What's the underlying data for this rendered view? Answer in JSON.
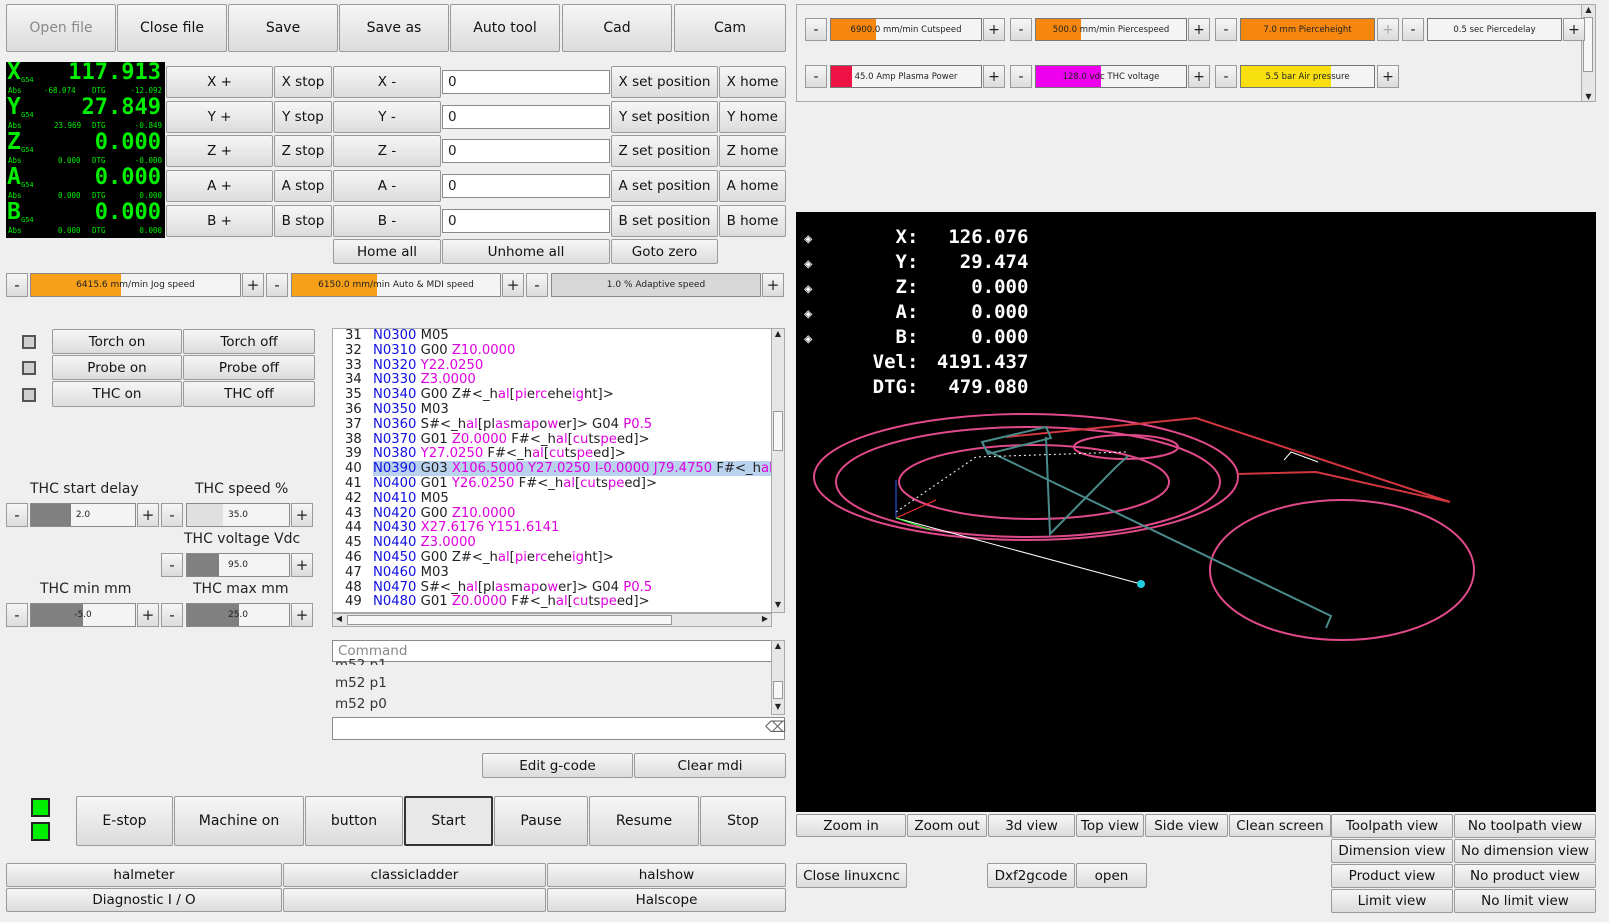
{
  "toolbar": [
    "Open file",
    "Close file",
    "Save",
    "Save as",
    "Auto tool",
    "Cad",
    "Cam"
  ],
  "dro": [
    {
      "axis": "X",
      "g": "G54",
      "value": "117.913",
      "abs": "-68.074",
      "dtg": "-12.092"
    },
    {
      "axis": "Y",
      "g": "G54",
      "value": "27.849",
      "abs": "23.969",
      "dtg": "-0.849"
    },
    {
      "axis": "Z",
      "g": "G54",
      "value": "0.000",
      "abs": "0.000",
      "dtg": "-0.000"
    },
    {
      "axis": "A",
      "g": "G54",
      "value": "0.000",
      "abs": "0.000",
      "dtg": "0.000"
    },
    {
      "axis": "B",
      "g": "G54",
      "value": "0.000",
      "abs": "0.000",
      "dtg": "0.000"
    }
  ],
  "dro_labels": {
    "abs": "Abs",
    "dtg": "DTG"
  },
  "axes": [
    {
      "plus": "X +",
      "stop": "X stop",
      "minus": "X -",
      "value": "0",
      "setpos": "X set position",
      "home": "X home"
    },
    {
      "plus": "Y +",
      "stop": "Y stop",
      "minus": "Y -",
      "value": "0",
      "setpos": "Y set position",
      "home": "Y home"
    },
    {
      "plus": "Z +",
      "stop": "Z stop",
      "minus": "Z -",
      "value": "0",
      "setpos": "Z set position",
      "home": "Z home"
    },
    {
      "plus": "A +",
      "stop": "A stop",
      "minus": "A -",
      "value": "0",
      "setpos": "A set position",
      "home": "A home"
    },
    {
      "plus": "B +",
      "stop": "B stop",
      "minus": "B -",
      "value": "0",
      "setpos": "B set position",
      "home": "B home"
    }
  ],
  "home_all": "Home all",
  "unhome_all": "Unhome all",
  "goto_zero": "Goto zero",
  "speeds": [
    {
      "label": "6415.6 mm/min Jog speed",
      "fill": 0.43,
      "color": "#f5a018"
    },
    {
      "label": "6150.0 mm/min Auto & MDI speed",
      "fill": 0.41,
      "color": "#f5a018"
    },
    {
      "label": "1.0  % Adaptive speed",
      "fill": 0.0,
      "color": "#f5a018"
    }
  ],
  "toggles": [
    {
      "on": "Torch on",
      "off": "Torch off"
    },
    {
      "on": "Probe on",
      "off": "Probe off"
    },
    {
      "on": "THC on",
      "off": "THC off"
    }
  ],
  "thc": {
    "start_delay_label": "THC start delay",
    "start_delay": "2.0",
    "speed_label": "THC speed %",
    "speed": "35.0",
    "voltage_label": "THC voltage Vdc",
    "voltage": "95.0",
    "min_label": "THC min mm",
    "min": "-5.0",
    "max_label": "THC max mm",
    "max": "25.0"
  },
  "gcode": [
    {
      "n": "31",
      "parts": [
        [
          "b",
          "N0300"
        ],
        [
          "k",
          " M05"
        ]
      ]
    },
    {
      "n": "32",
      "parts": [
        [
          "b",
          "N0310"
        ],
        [
          "k",
          " G00 "
        ],
        [
          "m",
          "Z10.0000"
        ]
      ]
    },
    {
      "n": "33",
      "parts": [
        [
          "b",
          "N0320"
        ],
        [
          "k",
          " "
        ],
        [
          "m",
          "Y22.0250"
        ]
      ]
    },
    {
      "n": "34",
      "parts": [
        [
          "b",
          "N0330"
        ],
        [
          "k",
          " "
        ],
        [
          "m",
          "Z3.0000"
        ]
      ]
    },
    {
      "n": "35",
      "parts": [
        [
          "b",
          "N0340"
        ],
        [
          "k",
          " G00 Z#<_h"
        ],
        [
          "m",
          "al"
        ],
        [
          "k",
          "["
        ],
        [
          "m",
          "pi"
        ],
        [
          "k",
          "e"
        ],
        [
          "m",
          "rc"
        ],
        [
          "k",
          "ehe"
        ],
        [
          "m",
          "ig"
        ],
        [
          "k",
          "ht]>"
        ]
      ]
    },
    {
      "n": "36",
      "parts": [
        [
          "b",
          "N0350"
        ],
        [
          "k",
          " M03"
        ]
      ]
    },
    {
      "n": "37",
      "parts": [
        [
          "b",
          "N0360"
        ],
        [
          "k",
          " S#<_h"
        ],
        [
          "m",
          "al"
        ],
        [
          "k",
          "[pl"
        ],
        [
          "m",
          "as"
        ],
        [
          "k",
          "m"
        ],
        [
          "m",
          "ap"
        ],
        [
          "k",
          "o"
        ],
        [
          "m",
          "w"
        ],
        [
          "k",
          "er]> G04 "
        ],
        [
          "m",
          "P0.5"
        ]
      ]
    },
    {
      "n": "38",
      "parts": [
        [
          "b",
          "N0370"
        ],
        [
          "k",
          " G01 "
        ],
        [
          "m",
          "Z0.0000"
        ],
        [
          "k",
          " F#<_h"
        ],
        [
          "m",
          "al"
        ],
        [
          "k",
          "["
        ],
        [
          "m",
          "cu"
        ],
        [
          "k",
          "ts"
        ],
        [
          "m",
          "pe"
        ],
        [
          "k",
          "ed]>"
        ]
      ]
    },
    {
      "n": "39",
      "parts": [
        [
          "b",
          "N0380"
        ],
        [
          "k",
          " "
        ],
        [
          "m",
          "Y27.0250"
        ],
        [
          "k",
          " F#<_h"
        ],
        [
          "m",
          "al"
        ],
        [
          "k",
          "["
        ],
        [
          "m",
          "cu"
        ],
        [
          "k",
          "ts"
        ],
        [
          "m",
          "pe"
        ],
        [
          "k",
          "ed]>"
        ]
      ]
    },
    {
      "n": "40",
      "hl": true,
      "parts": [
        [
          "b",
          "N0390"
        ],
        [
          "k",
          " G03 "
        ],
        [
          "m",
          "X106.5000 Y27.0250 I-0.0000 J79.4750"
        ],
        [
          "k",
          " F#<_h"
        ],
        [
          "m",
          "al"
        ]
      ]
    },
    {
      "n": "41",
      "parts": [
        [
          "b",
          "N0400"
        ],
        [
          "k",
          " G01 "
        ],
        [
          "m",
          "Y26.0250"
        ],
        [
          "k",
          " F#<_h"
        ],
        [
          "m",
          "al"
        ],
        [
          "k",
          "["
        ],
        [
          "m",
          "cu"
        ],
        [
          "k",
          "ts"
        ],
        [
          "m",
          "pe"
        ],
        [
          "k",
          "ed]>"
        ]
      ]
    },
    {
      "n": "42",
      "parts": [
        [
          "b",
          "N0410"
        ],
        [
          "k",
          " M05"
        ]
      ]
    },
    {
      "n": "43",
      "parts": [
        [
          "b",
          "N0420"
        ],
        [
          "k",
          " G00 "
        ],
        [
          "m",
          "Z10.0000"
        ]
      ]
    },
    {
      "n": "44",
      "parts": [
        [
          "b",
          "N0430"
        ],
        [
          "k",
          " "
        ],
        [
          "m",
          "X27.6176 Y151.6141"
        ]
      ]
    },
    {
      "n": "45",
      "parts": [
        [
          "b",
          "N0440"
        ],
        [
          "k",
          " "
        ],
        [
          "m",
          "Z3.0000"
        ]
      ]
    },
    {
      "n": "46",
      "parts": [
        [
          "b",
          "N0450"
        ],
        [
          "k",
          " G00 Z#<_h"
        ],
        [
          "m",
          "al"
        ],
        [
          "k",
          "["
        ],
        [
          "m",
          "pi"
        ],
        [
          "k",
          "e"
        ],
        [
          "m",
          "rc"
        ],
        [
          "k",
          "ehe"
        ],
        [
          "m",
          "ig"
        ],
        [
          "k",
          "ht]>"
        ]
      ]
    },
    {
      "n": "47",
      "parts": [
        [
          "b",
          "N0460"
        ],
        [
          "k",
          " M03"
        ]
      ]
    },
    {
      "n": "48",
      "parts": [
        [
          "b",
          "N0470"
        ],
        [
          "k",
          " S#<_h"
        ],
        [
          "m",
          "al"
        ],
        [
          "k",
          "[pl"
        ],
        [
          "m",
          "as"
        ],
        [
          "k",
          "m"
        ],
        [
          "m",
          "ap"
        ],
        [
          "k",
          "o"
        ],
        [
          "m",
          "w"
        ],
        [
          "k",
          "er]> G04 "
        ],
        [
          "m",
          "P0.5"
        ]
      ]
    },
    {
      "n": "49",
      "parts": [
        [
          "b",
          "N0480"
        ],
        [
          "k",
          " G01 "
        ],
        [
          "m",
          "Z0.0000"
        ],
        [
          "k",
          " F#<_h"
        ],
        [
          "m",
          "al"
        ],
        [
          "k",
          "["
        ],
        [
          "m",
          "cu"
        ],
        [
          "k",
          "ts"
        ],
        [
          "m",
          "pe"
        ],
        [
          "k",
          "ed]>"
        ]
      ]
    }
  ],
  "mdi": {
    "placeholder": "Command",
    "history": [
      "m52 p1",
      "m52 p1",
      "m52 p0"
    ],
    "value": ""
  },
  "edit_gcode": "Edit g-code",
  "clear_mdi": "Clear mdi",
  "control": [
    "E-stop",
    "Machine on",
    "button",
    "Start",
    "Pause",
    "Resume",
    "Stop"
  ],
  "tools": {
    "halmeter": "halmeter",
    "classicladder": "classicladder",
    "halshow": "halshow",
    "diag": "Diagnostic I / O",
    "blank": "",
    "halscope": "Halscope"
  },
  "params": [
    {
      "label": "6900.0 mm/min Cutspeed",
      "fill": 0.3,
      "color": "#f5870f"
    },
    {
      "label": "500.0 mm/min Piercespeed",
      "fill": 0.3,
      "color": "#f5870f"
    },
    {
      "label": "7.0 mm Pierceheight",
      "fill": 1.0,
      "color": "#f5870f"
    },
    {
      "label": "0.5 sec Piercedelay",
      "fill": 0.0,
      "color": "#f5870f"
    },
    {
      "label": "45.0 Amp Plasma Power",
      "fill": 0.14,
      "color": "#ee1144"
    },
    {
      "label": "128.0 vdc THC voltage",
      "fill": 0.43,
      "color": "#ee00ee"
    },
    {
      "label": "5.5 bar Air pressure",
      "fill": 0.68,
      "color": "#f8e010"
    }
  ],
  "preview": {
    "x": "126.076",
    "y": "29.474",
    "z": "0.000",
    "a": "0.000",
    "b": "0.000",
    "vel": "4191.437",
    "dtg": "479.080",
    "labels": {
      "x": "X:",
      "y": "Y:",
      "z": "Z:",
      "a": "A:",
      "b": "B:",
      "vel": "Vel:",
      "dtg": "DTG:"
    }
  },
  "view_buttons": [
    "Zoom in",
    "Zoom out",
    "3d view",
    "Top view",
    "Side view",
    "Clean screen"
  ],
  "view_toggles": [
    {
      "on": "Toolpath view",
      "off": "No toolpath view"
    },
    {
      "on": "Dimension view",
      "off": "No dimension view"
    },
    {
      "on": "Product view",
      "off": "No product view"
    },
    {
      "on": "Limit view",
      "off": "No limit view"
    }
  ],
  "close_linuxcnc": "Close linuxcnc",
  "dxf2gcode": "Dxf2gcode",
  "open": "open"
}
